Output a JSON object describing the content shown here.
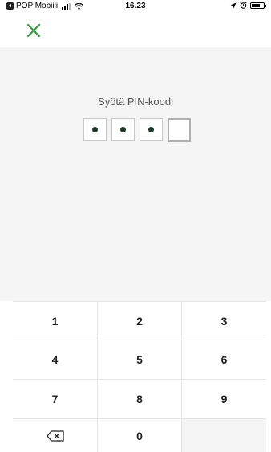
{
  "status_bar": {
    "carrier": "POP Mobiili",
    "time": "16.23",
    "icons": {
      "back_app": "back-to-app-icon",
      "signal": "signal-icon",
      "wifi": "wifi-icon",
      "location": "location-arrow-icon",
      "alarm": "alarm-icon",
      "battery": "battery-icon"
    }
  },
  "nav": {
    "close_icon": "close-icon",
    "close_color": "#2e9e3e"
  },
  "pin": {
    "title": "Syötä PIN-koodi",
    "entered_digits": 3,
    "total_digits": 4
  },
  "keypad": {
    "keys": [
      "1",
      "2",
      "3",
      "4",
      "5",
      "6",
      "7",
      "8",
      "9",
      "",
      "0",
      ""
    ],
    "backspace_icon": "backspace-icon"
  },
  "colors": {
    "accent": "#2e9e3e",
    "background": "#f5f5f5",
    "pin_dot": "#1e3a2a"
  }
}
